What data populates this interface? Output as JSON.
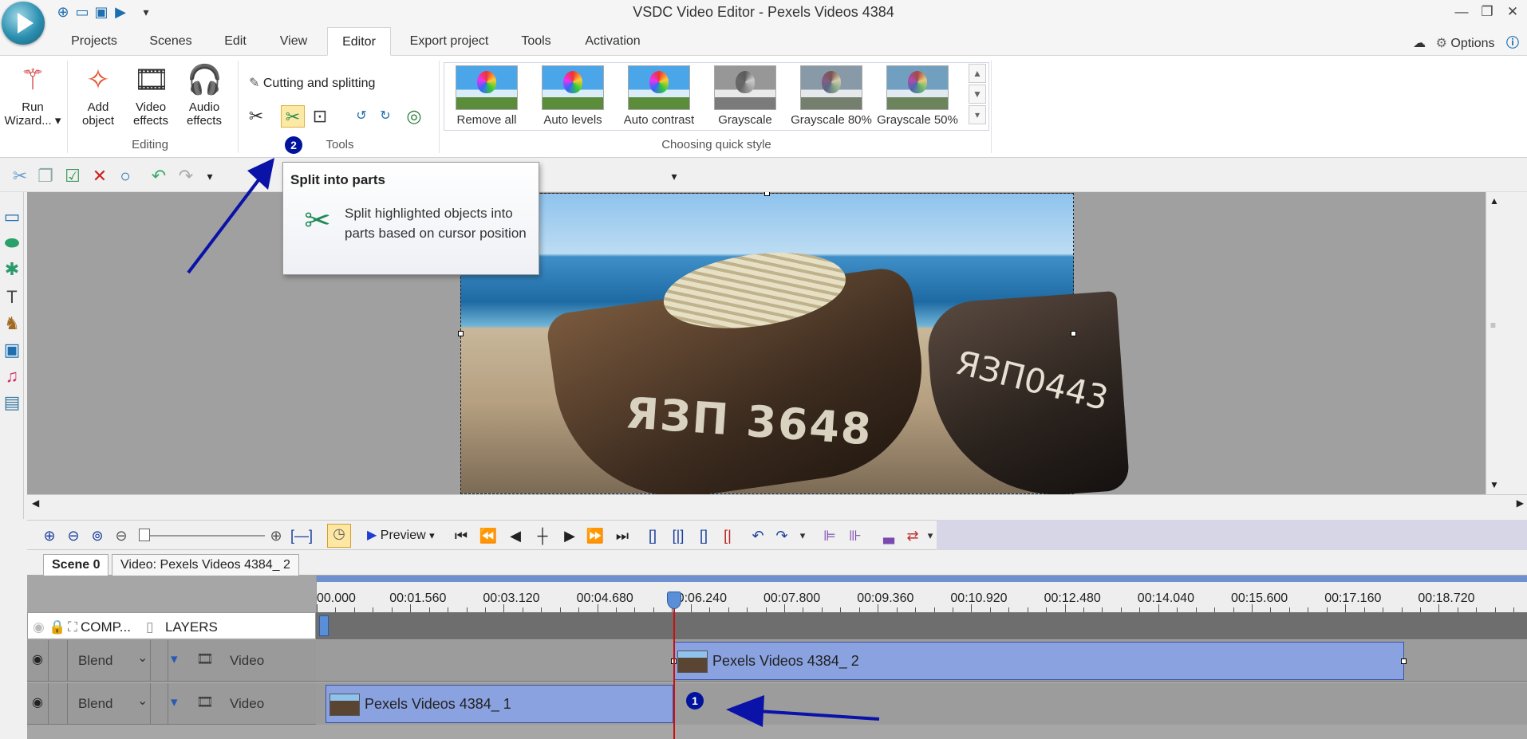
{
  "window": {
    "title": "VSDC Video Editor - Pexels Videos 4384"
  },
  "menu": {
    "tabs": [
      "Projects",
      "Scenes",
      "Edit",
      "View",
      "Editor",
      "Export project",
      "Tools",
      "Activation"
    ],
    "active": "Editor",
    "options_label": "Options"
  },
  "ribbon": {
    "editing": {
      "run_wizard": "Run\nWizard...",
      "add_object": "Add\nobject",
      "video_effects": "Video\neffects",
      "audio_effects": "Audio\neffects",
      "group_label": "Editing"
    },
    "tools": {
      "cutting_label": "Cutting and splitting",
      "group_label": "Tools",
      "badge": "2"
    },
    "quick_style": {
      "group_label": "Choosing quick style",
      "items": [
        "Remove all",
        "Auto levels",
        "Auto contrast",
        "Grayscale",
        "Grayscale 80%",
        "Grayscale 50%"
      ]
    }
  },
  "tooltip": {
    "title": "Split into parts",
    "description": "Split highlighted objects into parts based on cursor position"
  },
  "preview": {
    "boat1_text": "ЯЗП 3648",
    "boat2_text": "ЯЗП0443"
  },
  "timeline_toolbar": {
    "preview_label": "Preview"
  },
  "scene_tabs": [
    "Scene 0",
    "Video: Pexels Videos 4384_ 2"
  ],
  "timeline": {
    "ticks": [
      "00.000",
      "00:01.560",
      "00:03.120",
      "00:04.680",
      "00:06.240",
      "00:07.800",
      "00:09.360",
      "00:10.920",
      "00:12.480",
      "00:14.040",
      "00:15.600",
      "00:17.160",
      "00:18.720"
    ],
    "header": {
      "comp": "COMP...",
      "layers": "LAYERS"
    },
    "tracks": [
      {
        "blend": "Blend",
        "type": "Video",
        "clip": "Pexels Videos 4384_ 2"
      },
      {
        "blend": "Blend",
        "type": "Video",
        "clip": "Pexels Videos 4384_ 1"
      }
    ],
    "badge": "1"
  },
  "colors": {
    "accent": "#1e6fb0",
    "badge": "#00139c",
    "clip": "#8aa2e0",
    "cursor": "#cc1010"
  }
}
